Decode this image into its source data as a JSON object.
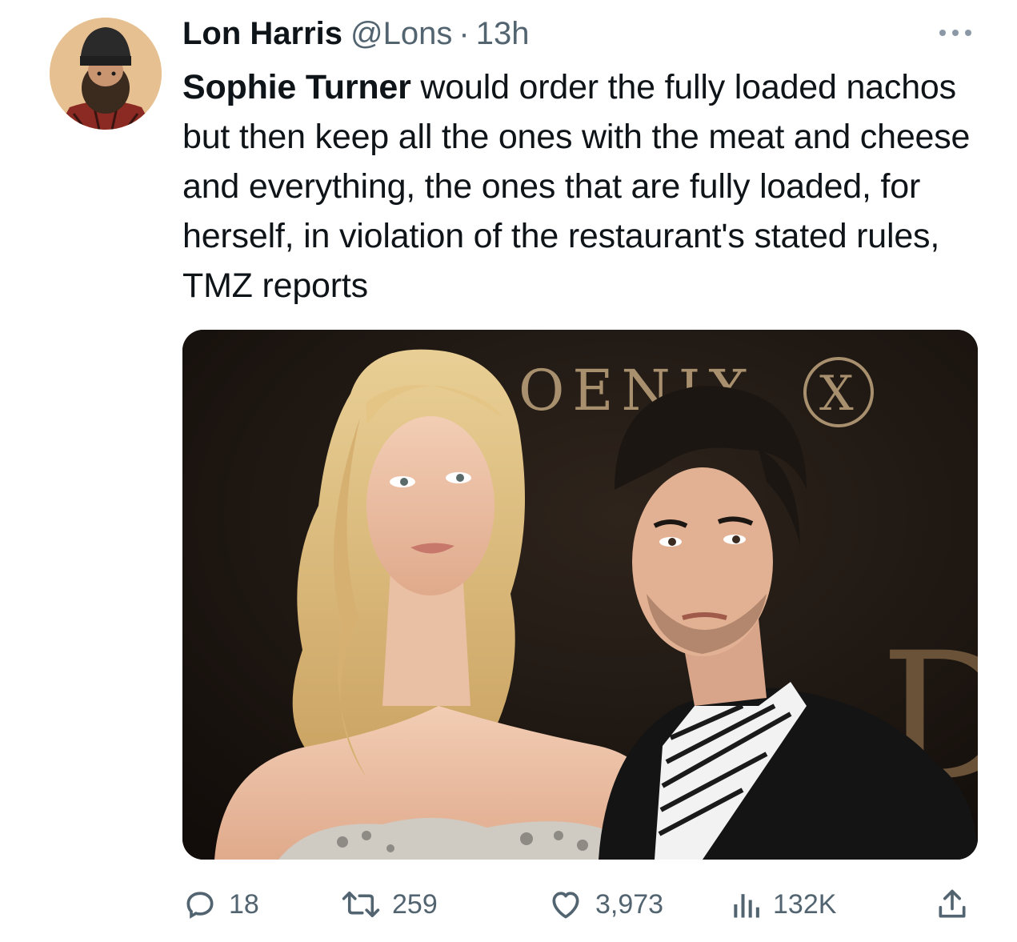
{
  "tweet": {
    "author": {
      "display_name": "Lon Harris",
      "handle": "@Lons",
      "separator": "·",
      "time": "13h"
    },
    "text": {
      "mention": "Sophie Turner",
      "body": " would order the fully loaded nachos but then keep all the ones with the meat and cheese and everything, the ones that are fully loaded, for herself, in violation of the restaurant's stated rules, TMZ reports"
    },
    "media": {
      "backdrop_text": "OENIX",
      "backdrop_logo": "X",
      "backdrop_letter": "D"
    },
    "actions": {
      "replies": "18",
      "retweets": "259",
      "likes": "3,973",
      "views": "132K"
    },
    "colors": {
      "text": "#0f1419",
      "secondary": "#536471",
      "background": "#ffffff"
    },
    "icons": {
      "more": "more-icon",
      "reply": "reply-icon",
      "retweet": "retweet-icon",
      "like": "heart-icon",
      "views": "views-icon",
      "share": "share-icon"
    }
  }
}
